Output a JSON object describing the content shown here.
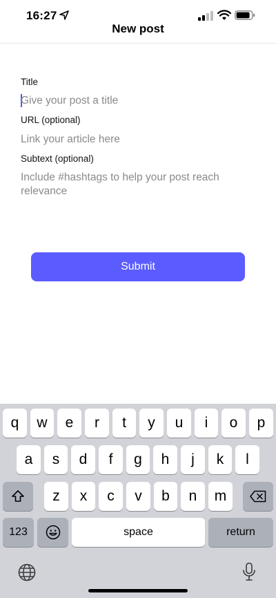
{
  "status_bar": {
    "time": "16:27",
    "icons": [
      "location-arrow-icon",
      "cellular-signal-icon",
      "wifi-icon",
      "battery-icon"
    ]
  },
  "header": {
    "title": "New post"
  },
  "form": {
    "title_label": "Title",
    "title_placeholder": "Give your post a title",
    "url_label": "URL (optional)",
    "url_placeholder": "Link your article here",
    "subtext_label": "Subtext (optional)",
    "subtext_placeholder": "Include #hashtags to help your post reach relevance"
  },
  "submit_label": "Submit",
  "keyboard": {
    "row1": [
      "q",
      "w",
      "e",
      "r",
      "t",
      "y",
      "u",
      "i",
      "o",
      "p"
    ],
    "row2": [
      "a",
      "s",
      "d",
      "f",
      "g",
      "h",
      "j",
      "k",
      "l"
    ],
    "row3": [
      "z",
      "x",
      "c",
      "v",
      "b",
      "n",
      "m"
    ],
    "numbers_label": "123",
    "space_label": "space",
    "return_label": "return",
    "icons": [
      "shift-icon",
      "backspace-icon",
      "emoji-icon",
      "globe-icon",
      "microphone-icon"
    ]
  },
  "colors": {
    "accent": "#5b5cff",
    "keyboard_bg": "#d1d3d9",
    "placeholder": "#8a8a8a"
  }
}
